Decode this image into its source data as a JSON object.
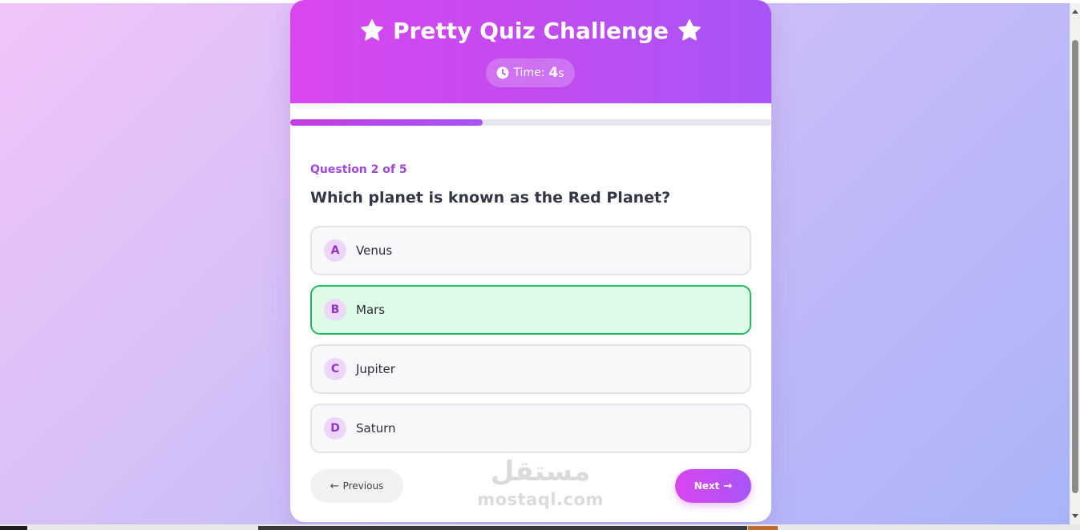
{
  "quiz": {
    "title": "Pretty Quiz Challenge",
    "timer": {
      "label": "Time:",
      "value": "4",
      "unit": "s"
    },
    "progress_fraction": 0.4,
    "question_counter": "Question 2 of 5",
    "question": "Which planet is known as the Red Planet?",
    "options": [
      {
        "letter": "A",
        "label": "Venus",
        "selected": false
      },
      {
        "letter": "B",
        "label": "Mars",
        "selected": true
      },
      {
        "letter": "C",
        "label": "Jupiter",
        "selected": false
      },
      {
        "letter": "D",
        "label": "Saturn",
        "selected": false
      }
    ],
    "prev_label": "Previous",
    "next_label": "Next"
  },
  "watermark": {
    "arabic": "مستقل",
    "latin": "mostaql.com"
  },
  "icons": {
    "title_icon": "star-icon",
    "timer_icon": "clock-icon",
    "prev_icon": "arrow-left-icon",
    "next_icon": "arrow-right-icon"
  },
  "colors": {
    "accent": "#d946ef",
    "accent_end": "#a855f7",
    "correct_bg": "#ddfbe7",
    "correct_border": "#23b85f"
  }
}
